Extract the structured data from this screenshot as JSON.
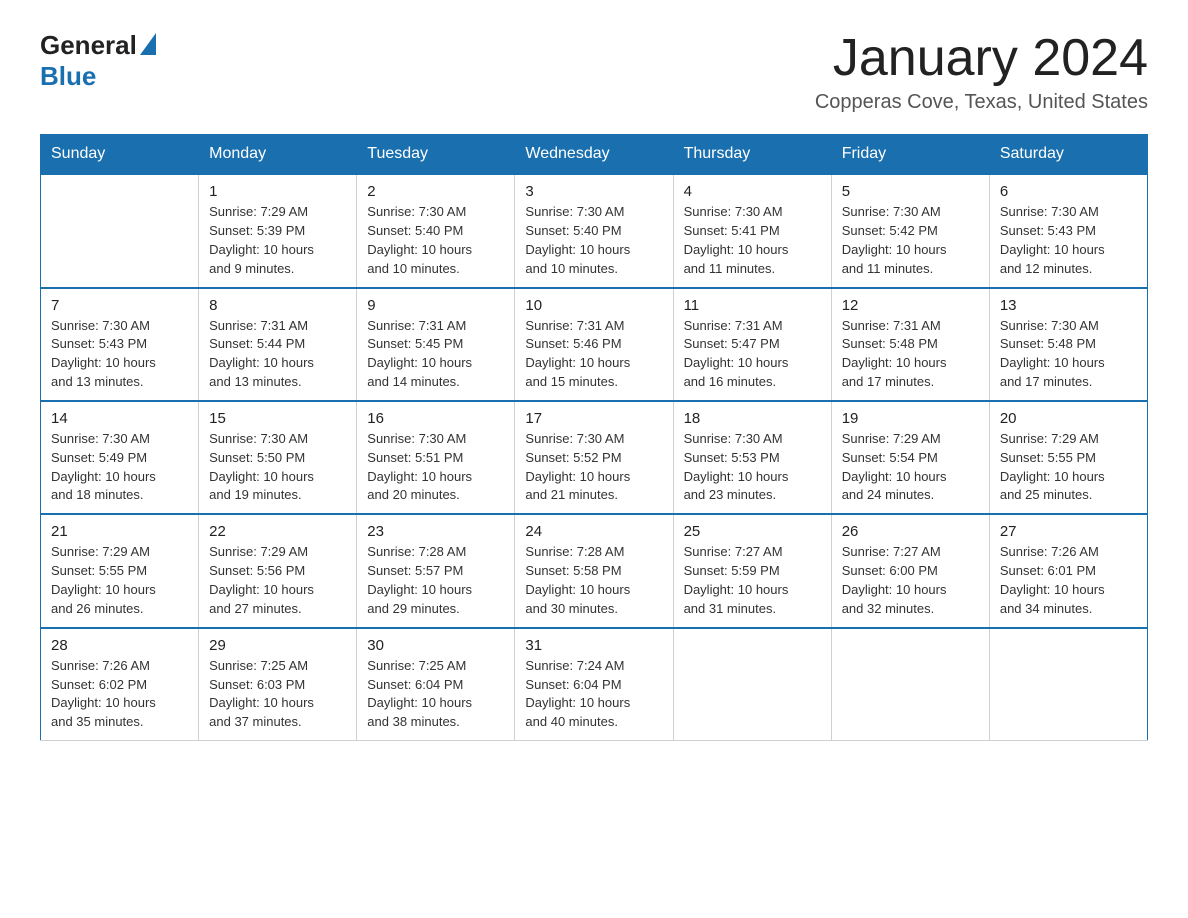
{
  "header": {
    "logo_general": "General",
    "logo_blue": "Blue",
    "title": "January 2024",
    "subtitle": "Copperas Cove, Texas, United States"
  },
  "columns": [
    "Sunday",
    "Monday",
    "Tuesday",
    "Wednesday",
    "Thursday",
    "Friday",
    "Saturday"
  ],
  "weeks": [
    [
      {
        "num": "",
        "info": ""
      },
      {
        "num": "1",
        "info": "Sunrise: 7:29 AM\nSunset: 5:39 PM\nDaylight: 10 hours\nand 9 minutes."
      },
      {
        "num": "2",
        "info": "Sunrise: 7:30 AM\nSunset: 5:40 PM\nDaylight: 10 hours\nand 10 minutes."
      },
      {
        "num": "3",
        "info": "Sunrise: 7:30 AM\nSunset: 5:40 PM\nDaylight: 10 hours\nand 10 minutes."
      },
      {
        "num": "4",
        "info": "Sunrise: 7:30 AM\nSunset: 5:41 PM\nDaylight: 10 hours\nand 11 minutes."
      },
      {
        "num": "5",
        "info": "Sunrise: 7:30 AM\nSunset: 5:42 PM\nDaylight: 10 hours\nand 11 minutes."
      },
      {
        "num": "6",
        "info": "Sunrise: 7:30 AM\nSunset: 5:43 PM\nDaylight: 10 hours\nand 12 minutes."
      }
    ],
    [
      {
        "num": "7",
        "info": "Sunrise: 7:30 AM\nSunset: 5:43 PM\nDaylight: 10 hours\nand 13 minutes."
      },
      {
        "num": "8",
        "info": "Sunrise: 7:31 AM\nSunset: 5:44 PM\nDaylight: 10 hours\nand 13 minutes."
      },
      {
        "num": "9",
        "info": "Sunrise: 7:31 AM\nSunset: 5:45 PM\nDaylight: 10 hours\nand 14 minutes."
      },
      {
        "num": "10",
        "info": "Sunrise: 7:31 AM\nSunset: 5:46 PM\nDaylight: 10 hours\nand 15 minutes."
      },
      {
        "num": "11",
        "info": "Sunrise: 7:31 AM\nSunset: 5:47 PM\nDaylight: 10 hours\nand 16 minutes."
      },
      {
        "num": "12",
        "info": "Sunrise: 7:31 AM\nSunset: 5:48 PM\nDaylight: 10 hours\nand 17 minutes."
      },
      {
        "num": "13",
        "info": "Sunrise: 7:30 AM\nSunset: 5:48 PM\nDaylight: 10 hours\nand 17 minutes."
      }
    ],
    [
      {
        "num": "14",
        "info": "Sunrise: 7:30 AM\nSunset: 5:49 PM\nDaylight: 10 hours\nand 18 minutes."
      },
      {
        "num": "15",
        "info": "Sunrise: 7:30 AM\nSunset: 5:50 PM\nDaylight: 10 hours\nand 19 minutes."
      },
      {
        "num": "16",
        "info": "Sunrise: 7:30 AM\nSunset: 5:51 PM\nDaylight: 10 hours\nand 20 minutes."
      },
      {
        "num": "17",
        "info": "Sunrise: 7:30 AM\nSunset: 5:52 PM\nDaylight: 10 hours\nand 21 minutes."
      },
      {
        "num": "18",
        "info": "Sunrise: 7:30 AM\nSunset: 5:53 PM\nDaylight: 10 hours\nand 23 minutes."
      },
      {
        "num": "19",
        "info": "Sunrise: 7:29 AM\nSunset: 5:54 PM\nDaylight: 10 hours\nand 24 minutes."
      },
      {
        "num": "20",
        "info": "Sunrise: 7:29 AM\nSunset: 5:55 PM\nDaylight: 10 hours\nand 25 minutes."
      }
    ],
    [
      {
        "num": "21",
        "info": "Sunrise: 7:29 AM\nSunset: 5:55 PM\nDaylight: 10 hours\nand 26 minutes."
      },
      {
        "num": "22",
        "info": "Sunrise: 7:29 AM\nSunset: 5:56 PM\nDaylight: 10 hours\nand 27 minutes."
      },
      {
        "num": "23",
        "info": "Sunrise: 7:28 AM\nSunset: 5:57 PM\nDaylight: 10 hours\nand 29 minutes."
      },
      {
        "num": "24",
        "info": "Sunrise: 7:28 AM\nSunset: 5:58 PM\nDaylight: 10 hours\nand 30 minutes."
      },
      {
        "num": "25",
        "info": "Sunrise: 7:27 AM\nSunset: 5:59 PM\nDaylight: 10 hours\nand 31 minutes."
      },
      {
        "num": "26",
        "info": "Sunrise: 7:27 AM\nSunset: 6:00 PM\nDaylight: 10 hours\nand 32 minutes."
      },
      {
        "num": "27",
        "info": "Sunrise: 7:26 AM\nSunset: 6:01 PM\nDaylight: 10 hours\nand 34 minutes."
      }
    ],
    [
      {
        "num": "28",
        "info": "Sunrise: 7:26 AM\nSunset: 6:02 PM\nDaylight: 10 hours\nand 35 minutes."
      },
      {
        "num": "29",
        "info": "Sunrise: 7:25 AM\nSunset: 6:03 PM\nDaylight: 10 hours\nand 37 minutes."
      },
      {
        "num": "30",
        "info": "Sunrise: 7:25 AM\nSunset: 6:04 PM\nDaylight: 10 hours\nand 38 minutes."
      },
      {
        "num": "31",
        "info": "Sunrise: 7:24 AM\nSunset: 6:04 PM\nDaylight: 10 hours\nand 40 minutes."
      },
      {
        "num": "",
        "info": ""
      },
      {
        "num": "",
        "info": ""
      },
      {
        "num": "",
        "info": ""
      }
    ]
  ]
}
